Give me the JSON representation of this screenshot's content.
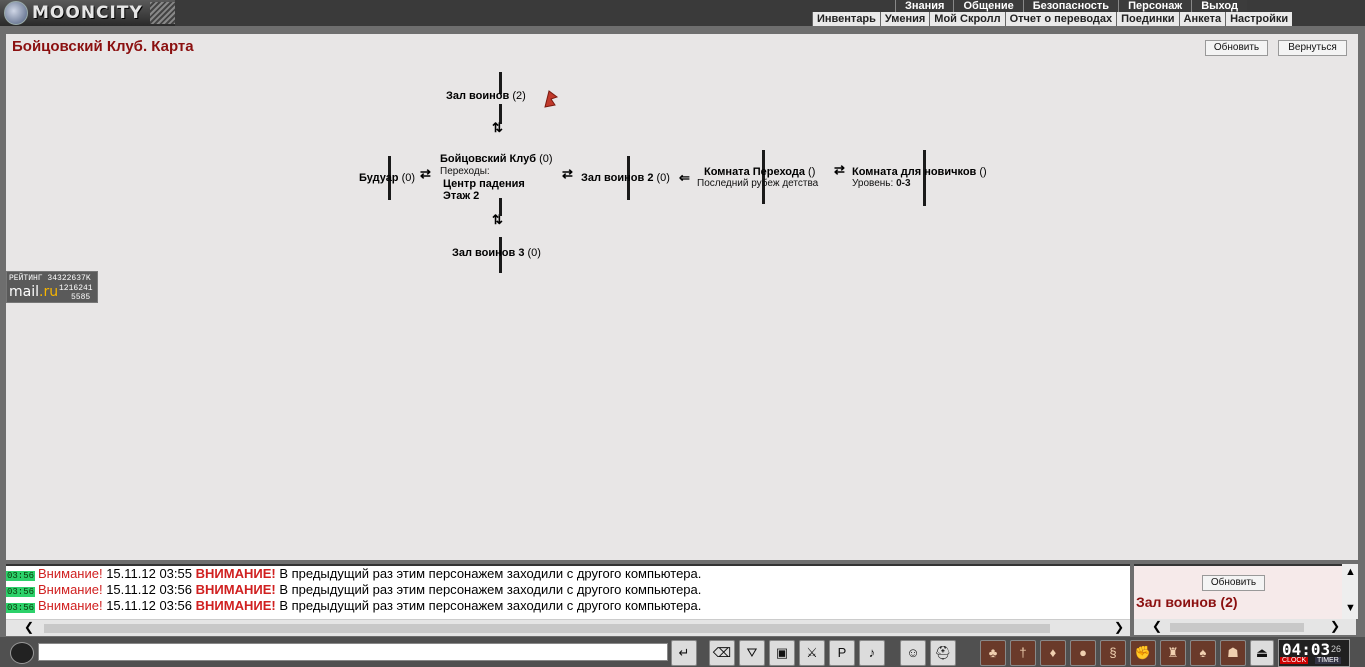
{
  "brand": {
    "name": "MOONCITY"
  },
  "menu_top": [
    "Знания",
    "Общение",
    "Безопасность",
    "Персонаж",
    "Выход"
  ],
  "menu_sub": [
    "Инвентарь",
    "Умения",
    "Мой Скролл",
    "Отчет о переводах",
    "Поединки",
    "Анкета",
    "Настройки"
  ],
  "page": {
    "title": "Бойцовский Клуб. Карта",
    "refresh": "Обновить",
    "back": "Вернуться"
  },
  "map": {
    "warriors_hall": {
      "name": "Зал воинов",
      "count": "(2)"
    },
    "club": {
      "name": "Бойцовский Клуб",
      "count": "(0)",
      "transitions_label": "Переходы:",
      "transition_1": "Центр падения",
      "transition_2": "Этаж 2"
    },
    "boudoir": {
      "name": "Будуар",
      "count": "(0)"
    },
    "warriors_hall2": {
      "name": "Зал воинов 2",
      "count": "(0)"
    },
    "transit_room": {
      "name": "Комната Перехода",
      "count": "()",
      "subtitle": "Последний рубеж детства"
    },
    "newbie_room": {
      "name": "Комната для новичков",
      "count": "()",
      "level_label": "Уровень:",
      "level_value": "0-3"
    },
    "warriors_hall3": {
      "name": "Зал воинов 3",
      "count": "(0)"
    }
  },
  "rating": {
    "title": "РЕЙТИНГ",
    "value": "34322637K",
    "logo_main": "mail",
    "logo_tld": ".ru",
    "num1": "1216241",
    "num2": "5585"
  },
  "chat": [
    {
      "time": "03:56",
      "attention": "Внимание!",
      "date": "15.11.12 03:55",
      "attention_caps": "ВНИМАНИЕ!",
      "text": "В предыдущий раз этим персонажем заходили с другого компьютера."
    },
    {
      "time": "03:56",
      "attention": "Внимание!",
      "date": "15.11.12 03:56",
      "attention_caps": "ВНИМАНИЕ!",
      "text": "В предыдущий раз этим персонажем заходили с другого компьютера."
    },
    {
      "time": "03:56",
      "attention": "Внимание!",
      "date": "15.11.12 03:56",
      "attention_caps": "ВНИМАНИЕ!",
      "text": "В предыдущий раз этим персонажем заходили с другого компьютера."
    }
  ],
  "side_panel": {
    "refresh": "Обновить",
    "room": "Зал воинов (2)"
  },
  "clock": {
    "time": "04:03",
    "seconds": "26",
    "label_clock": "CLOCK",
    "label_timer": "TIMER"
  },
  "colors": {
    "title": "#8b1010",
    "attention": "#d02020",
    "time_bg": "#2cd16a"
  },
  "toolbar_icons": [
    "enter-icon",
    "eraser-icon",
    "filter-icon",
    "save-icon",
    "fight-icon",
    "pl-icon",
    "sound-icon",
    "smiley-icon",
    "helmet-icon",
    "bag-icon",
    "sword-icon",
    "potion-icon",
    "gold-icon",
    "scroll-icon",
    "fist-icon",
    "armor-icon",
    "pouch-icon",
    "lock-icon",
    "group-icon",
    "exit-icon"
  ]
}
